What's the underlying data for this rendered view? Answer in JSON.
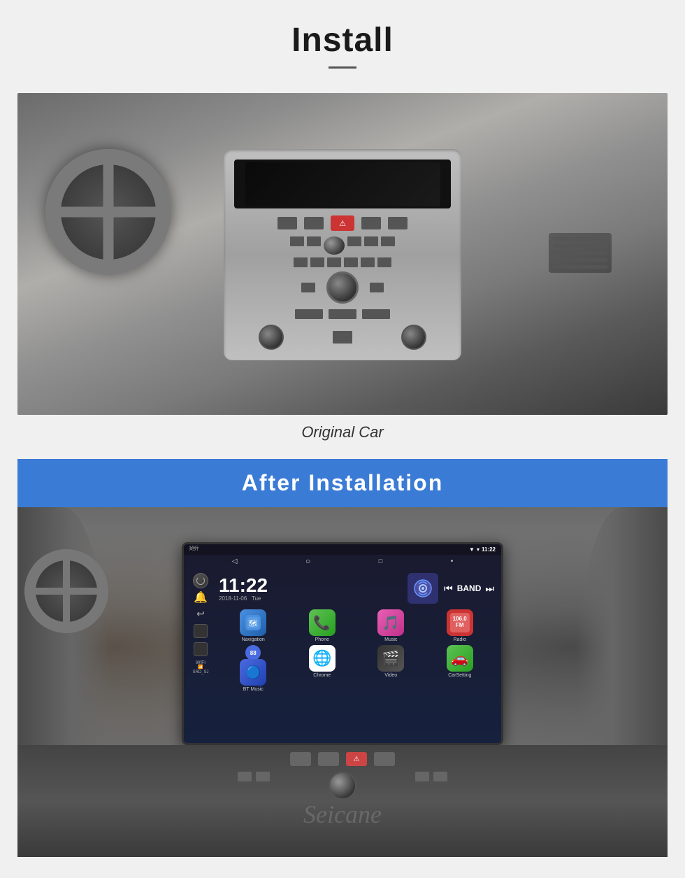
{
  "header": {
    "title": "Install",
    "divider": true
  },
  "original_car": {
    "label": "Original Car"
  },
  "after_installation": {
    "banner_text": "After  Installation",
    "screen": {
      "status_bar": {
        "signal": "▼",
        "wifi": "▾",
        "time": "11:22"
      },
      "nav_bar": {
        "back": "◁",
        "home": "○",
        "recents": "□",
        "dot": "•"
      },
      "clock": {
        "time": "11:22",
        "date": "2018-11-06",
        "day": "Tue"
      },
      "media": {
        "prev": "⏮",
        "band": "BAND",
        "next": "⏭"
      },
      "left_panel": {
        "power": "⏻",
        "wifi_label": "WiFi",
        "network": "SRD_SJ"
      },
      "apps_row1": [
        {
          "name": "Navigation",
          "icon": "🗺",
          "color": "nav-app"
        },
        {
          "name": "Phone",
          "icon": "📞",
          "color": "phone-app"
        },
        {
          "name": "Music",
          "icon": "🎵",
          "color": "music-app"
        },
        {
          "name": "Radio",
          "icon": "📻",
          "color": "radio-app"
        }
      ],
      "apps_row2": [
        {
          "name": "BT Music",
          "icon": "🔵",
          "color": "bt-app"
        },
        {
          "name": "Chrome",
          "icon": "🌐",
          "color": "chrome-app"
        },
        {
          "name": "Video",
          "icon": "🎬",
          "color": "video-app"
        },
        {
          "name": "CarSetting",
          "icon": "🚗",
          "color": "carsetting-app"
        }
      ],
      "num_badge": "88",
      "mic_label": "MIC"
    }
  },
  "watermark": "Seicane"
}
